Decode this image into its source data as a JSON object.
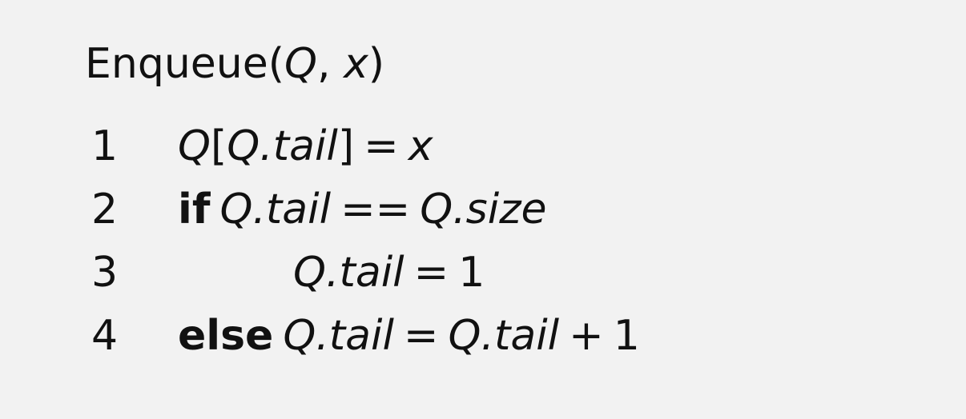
{
  "procedure": {
    "name": "Enqueue",
    "param_q": "Q",
    "param_sep": ", ",
    "param_x": "x",
    "open_paren": "(",
    "close_paren": ")"
  },
  "lines": [
    {
      "num": "1",
      "var": "Q",
      "bracket_open": "[",
      "field": "Q.tail",
      "bracket_close": "]",
      "op": "=",
      "rhs": "x"
    },
    {
      "num": "2",
      "keyword": "if",
      "lhs": "Q.tail",
      "op": "==",
      "rhs": "Q.size"
    },
    {
      "num": "3",
      "lhs": "Q.tail",
      "op": "=",
      "rhs": "1"
    },
    {
      "num": "4",
      "keyword": "else",
      "lhs": "Q.tail",
      "op": "=",
      "rhs": "Q.tail",
      "plus": "+",
      "rhs2": "1"
    }
  ]
}
